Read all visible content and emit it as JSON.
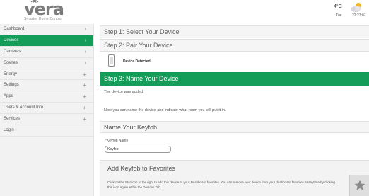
{
  "header": {
    "logo_text": "vera",
    "logo_tagline": "Smarter Home Control",
    "weather": {
      "temperature": "4°C",
      "day": "Tue",
      "time": "22:27:07",
      "icon": "partly-cloudy-icon"
    }
  },
  "sidebar": {
    "items": [
      {
        "label": "Dashboard",
        "indicator": "›"
      },
      {
        "label": "Devices",
        "indicator": "›",
        "active": true
      },
      {
        "label": "Cameras",
        "indicator": "›"
      },
      {
        "label": "Scenes",
        "indicator": "›"
      },
      {
        "label": "Energy",
        "indicator": "+"
      },
      {
        "label": "Settings",
        "indicator": "+"
      },
      {
        "label": "Apps",
        "indicator": "+"
      },
      {
        "label": "Users & Account Info",
        "indicator": "+"
      },
      {
        "label": "Services",
        "indicator": "+"
      },
      {
        "label": "Login",
        "indicator": ""
      }
    ]
  },
  "main": {
    "step1": "Step 1: Select Your Device",
    "step2": "Step 2: Pair Your Device",
    "detected": "Device Detected!",
    "step3": "Step 3: Name Your Device",
    "added_message": "The device was added.",
    "name_message": "Now you can name the device and indicate what room you will put it in.",
    "name_section_title": "Name Your Keyfob",
    "field_label": "*Keyfob Name",
    "field_value": "Keyfob",
    "favorites_title": "Add Keyfob to Favorites",
    "favorites_text": "Click on the Star icon to the right to add this device to your Dashboard favorites. You can remove your device from your dashboard favorites at anytime by clicking this icon again within the Devices Tab."
  },
  "colors": {
    "accent": "#139d59",
    "sidebar_bg": "#f2f2f2"
  }
}
